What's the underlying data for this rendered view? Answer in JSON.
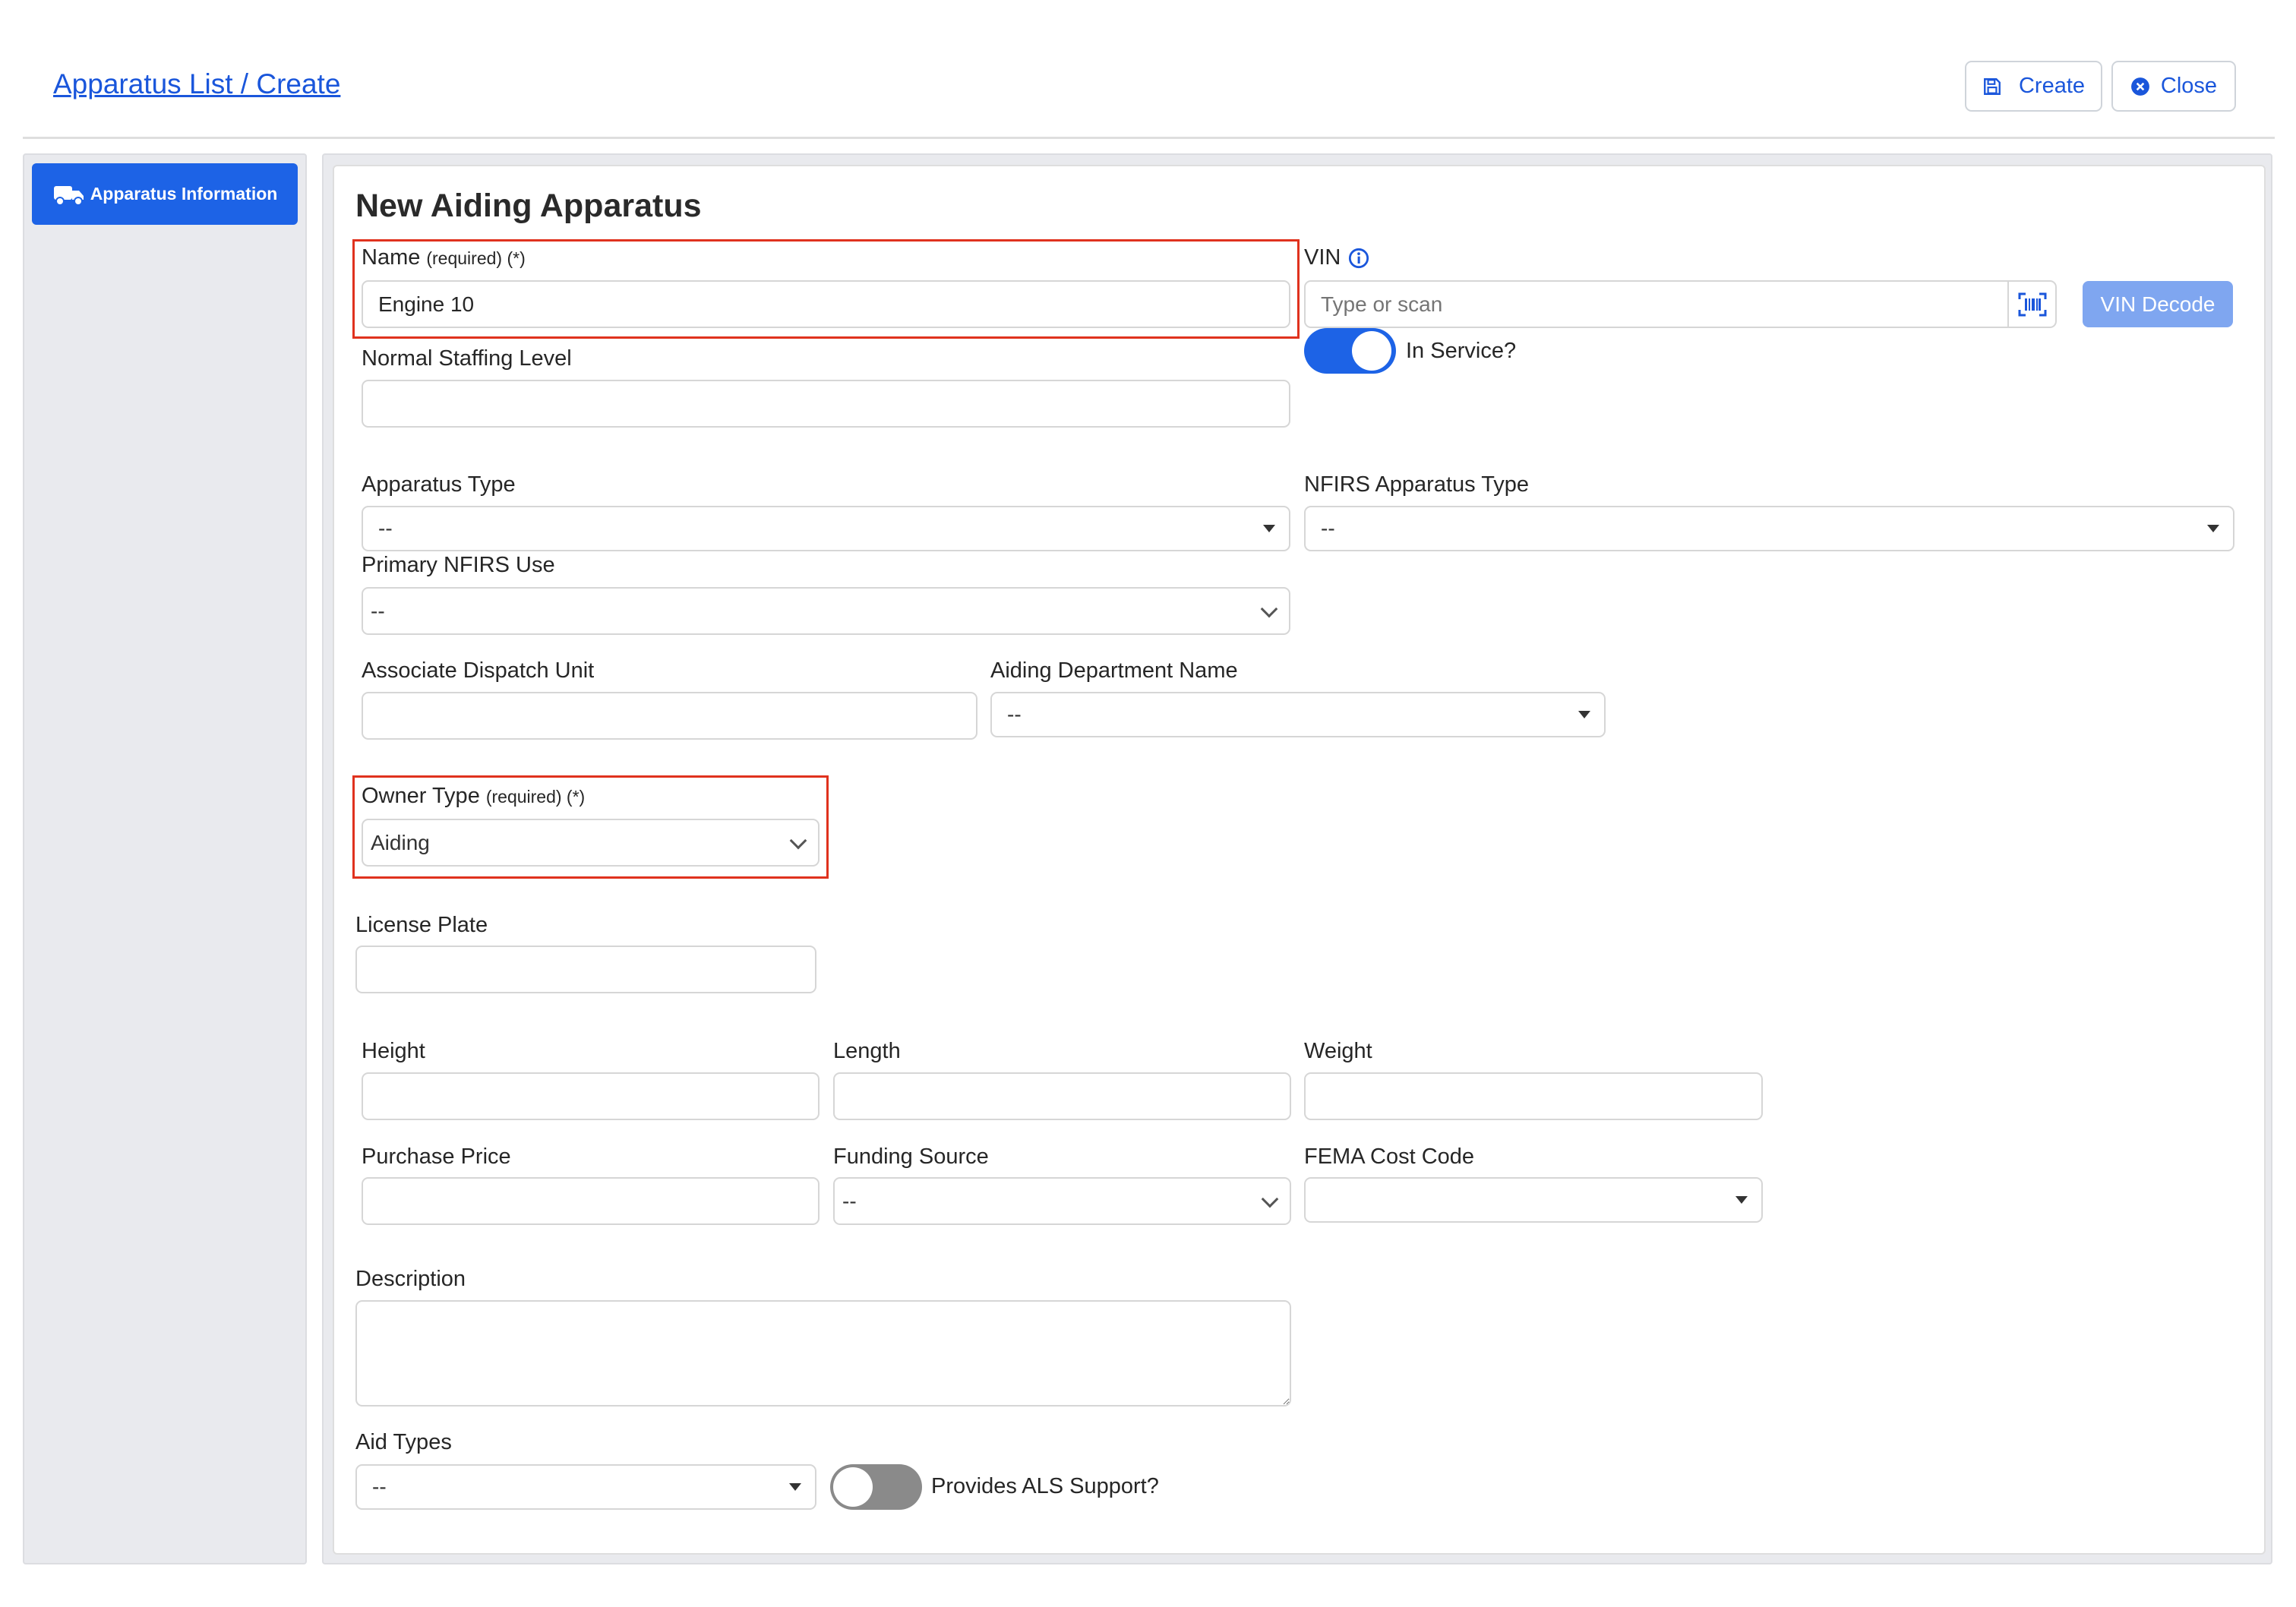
{
  "header": {
    "breadcrumb": "Apparatus List / Create",
    "create_label": "Create",
    "close_label": "Close"
  },
  "sidebar": {
    "items": [
      {
        "label": "Apparatus Information",
        "icon": "truck-icon",
        "active": true
      }
    ]
  },
  "form": {
    "title": "New Aiding Apparatus",
    "required_marker": "(required) (*)",
    "name": {
      "label": "Name",
      "value": "Engine 10"
    },
    "vin": {
      "label": "VIN",
      "placeholder": "Type or scan",
      "decode_label": "VIN Decode"
    },
    "in_service": {
      "label": "In Service?",
      "on": true
    },
    "normal_staffing": {
      "label": "Normal Staffing Level",
      "value": ""
    },
    "apparatus_type": {
      "label": "Apparatus Type",
      "value": "--"
    },
    "nfirs_apparatus_type": {
      "label": "NFIRS Apparatus Type",
      "value": "--"
    },
    "primary_nfirs_use": {
      "label": "Primary NFIRS Use",
      "value": "--"
    },
    "associate_dispatch_unit": {
      "label": "Associate Dispatch Unit",
      "value": ""
    },
    "aiding_department_name": {
      "label": "Aiding Department Name",
      "value": "--"
    },
    "owner_type": {
      "label": "Owner Type",
      "value": "Aiding"
    },
    "license_plate": {
      "label": "License Plate",
      "value": ""
    },
    "height": {
      "label": "Height",
      "value": ""
    },
    "length": {
      "label": "Length",
      "value": ""
    },
    "weight": {
      "label": "Weight",
      "value": ""
    },
    "purchase_price": {
      "label": "Purchase Price",
      "value": ""
    },
    "funding_source": {
      "label": "Funding Source",
      "value": "--"
    },
    "fema_cost_code": {
      "label": "FEMA Cost Code",
      "value": ""
    },
    "description": {
      "label": "Description",
      "value": ""
    },
    "aid_types": {
      "label": "Aid Types",
      "value": "--"
    },
    "als_support": {
      "label": "Provides ALS Support?",
      "on": false
    }
  },
  "colors": {
    "accent": "#1a56db",
    "sidebar_active": "#1d63e6",
    "highlight_box": "#e0321e",
    "toggle_on": "#1d63e6",
    "toggle_off": "#8a8a8a",
    "vin_decode_bg": "#7fa6f0"
  }
}
